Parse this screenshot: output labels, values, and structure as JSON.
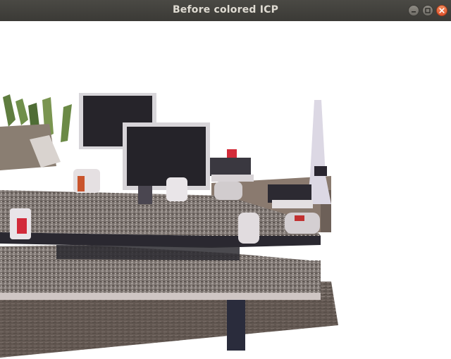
{
  "window": {
    "title": "Before colored ICP",
    "buttons": {
      "minimize": "minimize-icon",
      "maximize": "maximize-icon",
      "close": "close-icon"
    }
  },
  "viewport": {
    "content": "point-cloud-render",
    "background": "#ffffff"
  }
}
